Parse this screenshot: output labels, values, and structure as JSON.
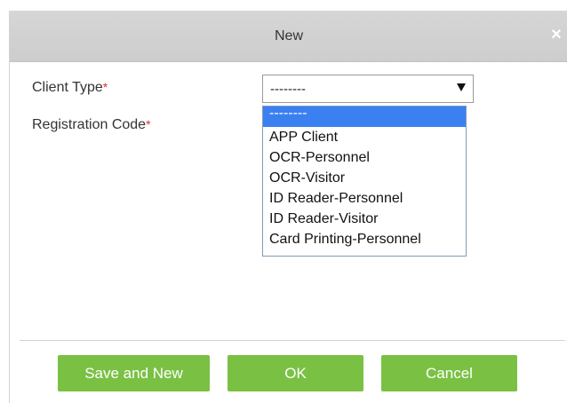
{
  "dialog": {
    "title": "New",
    "close_glyph": "×"
  },
  "form": {
    "client_type_label": "Client Type",
    "registration_code_label": "Registration Code",
    "required_mark": "*",
    "client_type_value": "--------"
  },
  "dropdown": {
    "options": [
      "--------",
      "APP Client",
      "OCR-Personnel",
      "OCR-Visitor",
      "ID Reader-Personnel",
      "ID Reader-Visitor",
      "Card Printing-Personnel"
    ],
    "selected_index": 0
  },
  "buttons": {
    "save_and_new": "Save and New",
    "ok": "OK",
    "cancel": "Cancel"
  },
  "colors": {
    "accent_green": "#7ac143",
    "selection_blue": "#3a80f0",
    "required_red": "#e03030"
  },
  "icons": {
    "close": "close-icon",
    "dropdown_arrow": "triangle-down-icon"
  }
}
